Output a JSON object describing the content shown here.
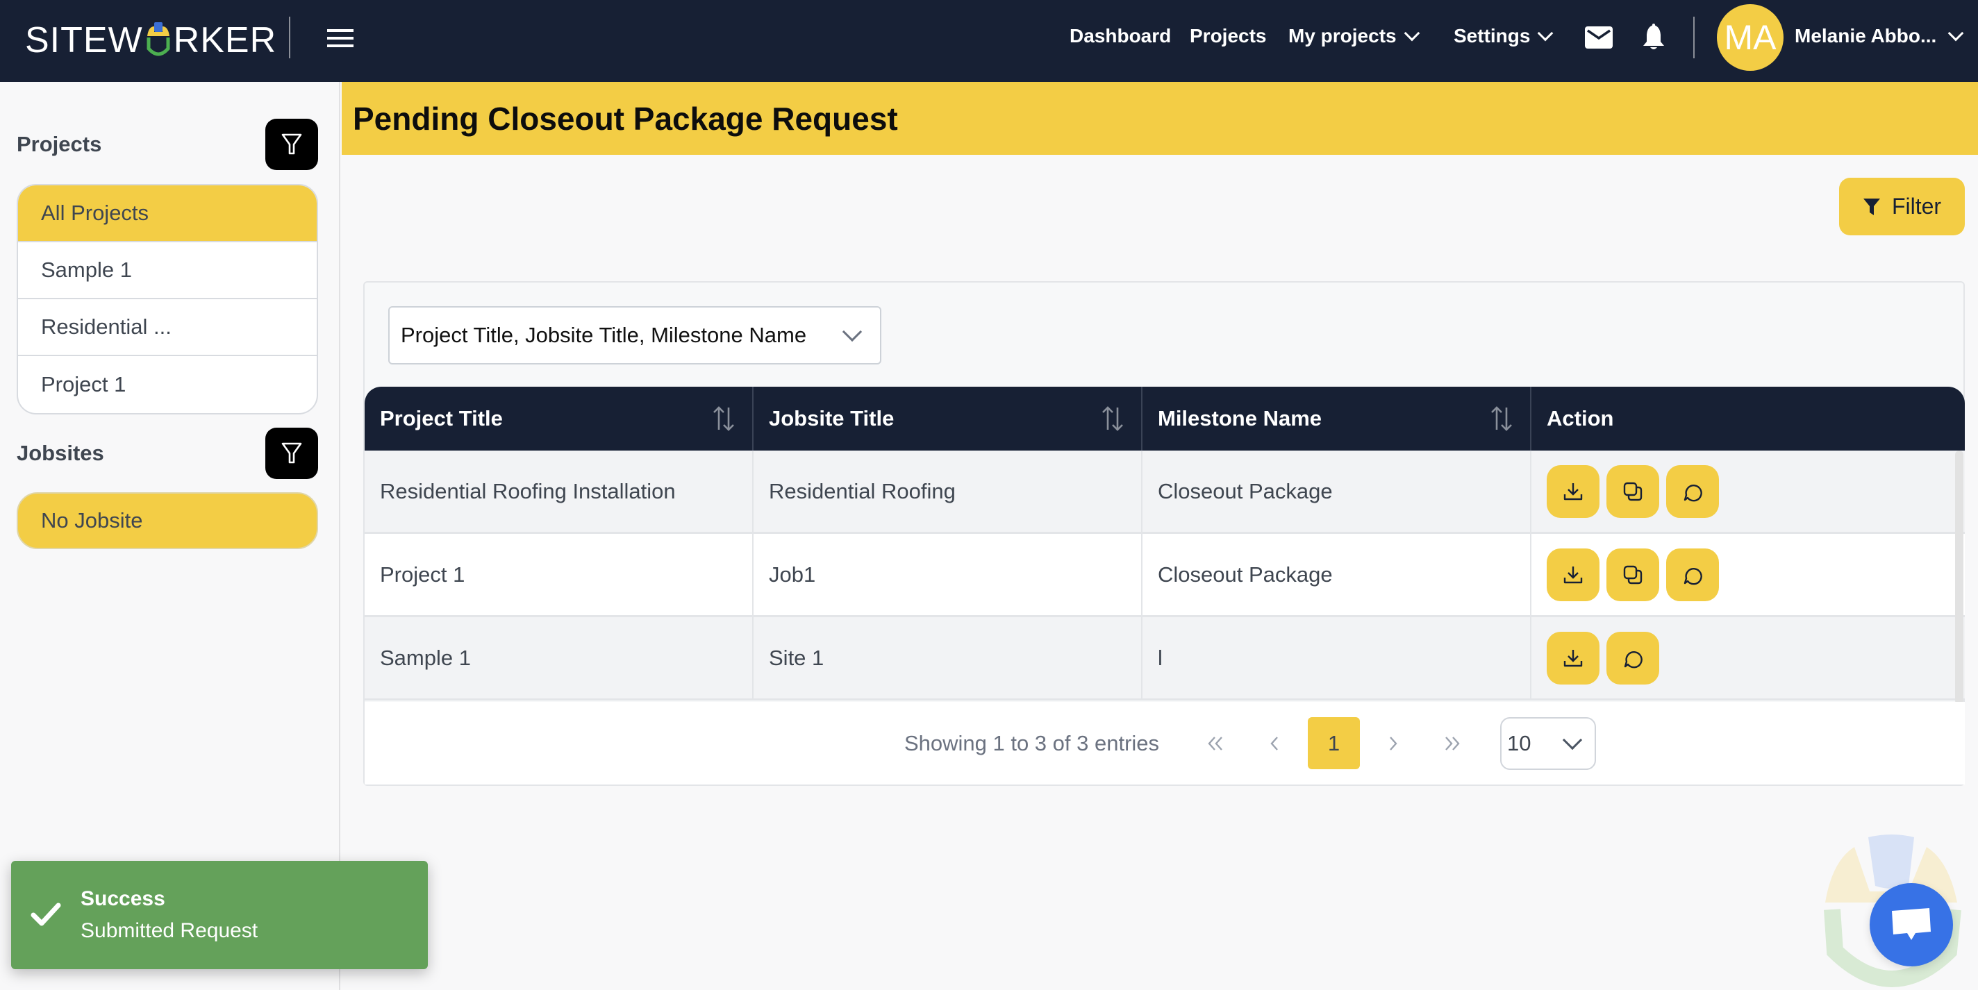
{
  "app": {
    "logo_text_left": "SITEW",
    "logo_text_right": "RKER",
    "colors": {
      "navy": "#172034",
      "accent_yellow": "#f3cd45",
      "success_green": "#64a15a",
      "chat_blue": "#3772e6"
    }
  },
  "topnav": {
    "links": [
      {
        "label": "Dashboard"
      },
      {
        "label": "Projects"
      },
      {
        "label": "My projects",
        "has_dropdown": true
      },
      {
        "label": "Settings",
        "has_dropdown": true
      }
    ],
    "icons": [
      "mail-icon",
      "bell-icon"
    ],
    "user": {
      "initials": "MA",
      "name": "Melanie Abbo..."
    }
  },
  "sidebar": {
    "projects": {
      "title": "Projects",
      "items": [
        {
          "label": "All Projects",
          "active": true
        },
        {
          "label": "Sample 1"
        },
        {
          "label": "Residential ..."
        },
        {
          "label": "Project 1"
        }
      ]
    },
    "jobsites": {
      "title": "Jobsites",
      "items": [
        {
          "label": "No Jobsite",
          "active": true
        }
      ]
    }
  },
  "page": {
    "title": "Pending Closeout Package Request",
    "filter_label": "Filter",
    "column_select_value": "Project Title, Jobsite Title, Milestone Name"
  },
  "table": {
    "columns": [
      {
        "label": "Project Title",
        "sortable": true
      },
      {
        "label": "Jobsite Title",
        "sortable": true
      },
      {
        "label": "Milestone Name",
        "sortable": true
      },
      {
        "label": "Action",
        "sortable": false
      }
    ],
    "rows": [
      {
        "project": "Residential Roofing Installation",
        "jobsite": "Residential Roofing",
        "milestone": "Closeout Package",
        "actions": [
          "download",
          "copy",
          "comment"
        ]
      },
      {
        "project": "Project 1",
        "jobsite": "Job1",
        "milestone": "Closeout Package",
        "actions": [
          "download",
          "copy",
          "comment"
        ]
      },
      {
        "project": "Sample 1",
        "jobsite": "Site 1",
        "milestone": "l",
        "actions": [
          "download",
          "comment"
        ]
      }
    ]
  },
  "pagination": {
    "info": "Showing 1 to 3 of 3 entries",
    "first": "«",
    "prev": "‹",
    "current_page": "1",
    "next": "›",
    "last": "»",
    "per_page": "10"
  },
  "toast": {
    "title": "Success",
    "message": "Submitted Request"
  }
}
